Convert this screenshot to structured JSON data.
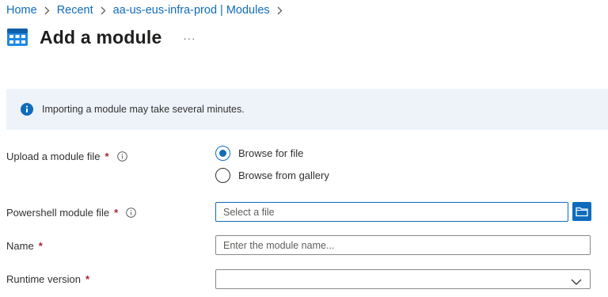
{
  "breadcrumb": {
    "items": [
      "Home",
      "Recent",
      "aa-us-eus-infra-prod | Modules"
    ]
  },
  "header": {
    "title": "Add a module",
    "more_label": "···",
    "icon": "module-icon"
  },
  "info": {
    "icon": "info-icon",
    "text": "Importing a module may take several minutes."
  },
  "form": {
    "upload": {
      "label": "Upload a module file",
      "required": "*",
      "options": [
        {
          "label": "Browse for file",
          "selected": true
        },
        {
          "label": "Browse from gallery",
          "selected": false
        }
      ]
    },
    "file": {
      "label": "Powershell module file",
      "required": "*",
      "placeholder": "Select a file",
      "value": "",
      "browse_icon": "folder-icon"
    },
    "name": {
      "label": "Name",
      "required": "*",
      "placeholder": "Enter the module name...",
      "value": ""
    },
    "runtime": {
      "label": "Runtime version",
      "required": "*",
      "value": ""
    }
  },
  "colors": {
    "accent": "#0f6cbd",
    "required": "#a4262c",
    "info_background": "#eef3fa",
    "text": "#323130"
  }
}
